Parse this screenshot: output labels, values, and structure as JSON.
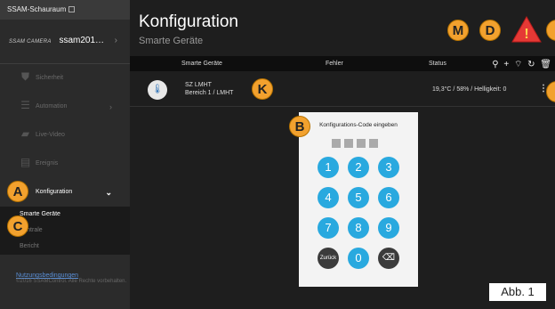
{
  "sidebar": {
    "top_title": "SSAM-Schauraum",
    "brand": "SSAM CAMERA",
    "user": "ssam201…",
    "items": [
      {
        "label": "Sicherheit"
      },
      {
        "label": "Automation"
      },
      {
        "label": "Live-Video"
      },
      {
        "label": "Ereignis"
      },
      {
        "label": "Konfiguration"
      }
    ],
    "subitems": [
      {
        "label": "Smarte Geräte"
      },
      {
        "label": "Zentrale"
      },
      {
        "label": "Bericht"
      }
    ],
    "footer_link": "Nutzungsbedingungen",
    "footer_text": "©2016 SSAMControl. Alle Rechte vorbehalten."
  },
  "header": {
    "title": "Konfiguration",
    "subtitle": "Smarte Geräte"
  },
  "table": {
    "columns": [
      "Smarte Geräte",
      "Fehler",
      "Status"
    ],
    "rows": [
      {
        "name": "SZ LMHT",
        "area": "Bereich 1 / LMHT",
        "status": "19,3°C / 58% / Helligkeit: 0"
      }
    ]
  },
  "keypad": {
    "title": "Konfigurations-Code eingeben",
    "keys": [
      "1",
      "2",
      "3",
      "4",
      "5",
      "6",
      "7",
      "8",
      "9"
    ],
    "back_label": "Zurück",
    "zero": "0"
  },
  "badges": {
    "A": "A",
    "B": "B",
    "C": "C",
    "D": "D",
    "K": "K",
    "M": "M",
    "warn": "!"
  },
  "figure_label": "Abb. 1",
  "colors": {
    "accent": "#29a9df",
    "badge": "#f2a12e",
    "warning": "#e53935"
  }
}
